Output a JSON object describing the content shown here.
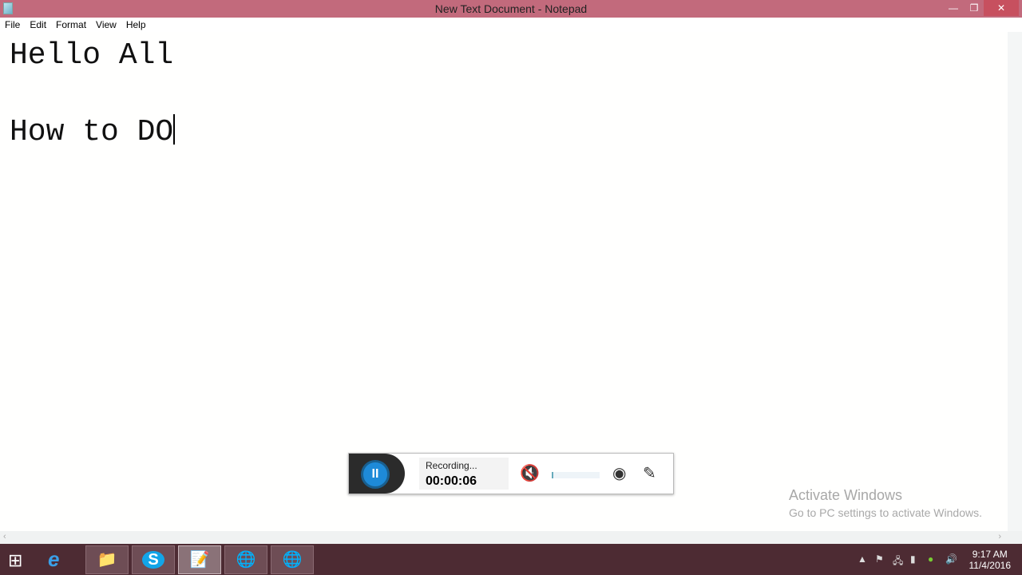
{
  "window": {
    "title": "New Text Document - Notepad",
    "minimize": "—",
    "restore": "❐",
    "close": "✕"
  },
  "menu": [
    "File",
    "Edit",
    "Format",
    "View",
    "Help"
  ],
  "document": {
    "line1": "Hello All",
    "line2": "",
    "line3": "How to DO"
  },
  "recorder": {
    "status": "Recording...",
    "time": "00:00:06",
    "pause": "II"
  },
  "watermark": {
    "heading": "Activate Windows",
    "sub": "Go to PC settings to activate Windows."
  },
  "tray": {
    "time": "9:17 AM",
    "date": "11/4/2016"
  },
  "colors": {
    "titlebar": "#c26a7c",
    "taskbar": "#4d2b33",
    "accent": "#1e8ad8"
  }
}
